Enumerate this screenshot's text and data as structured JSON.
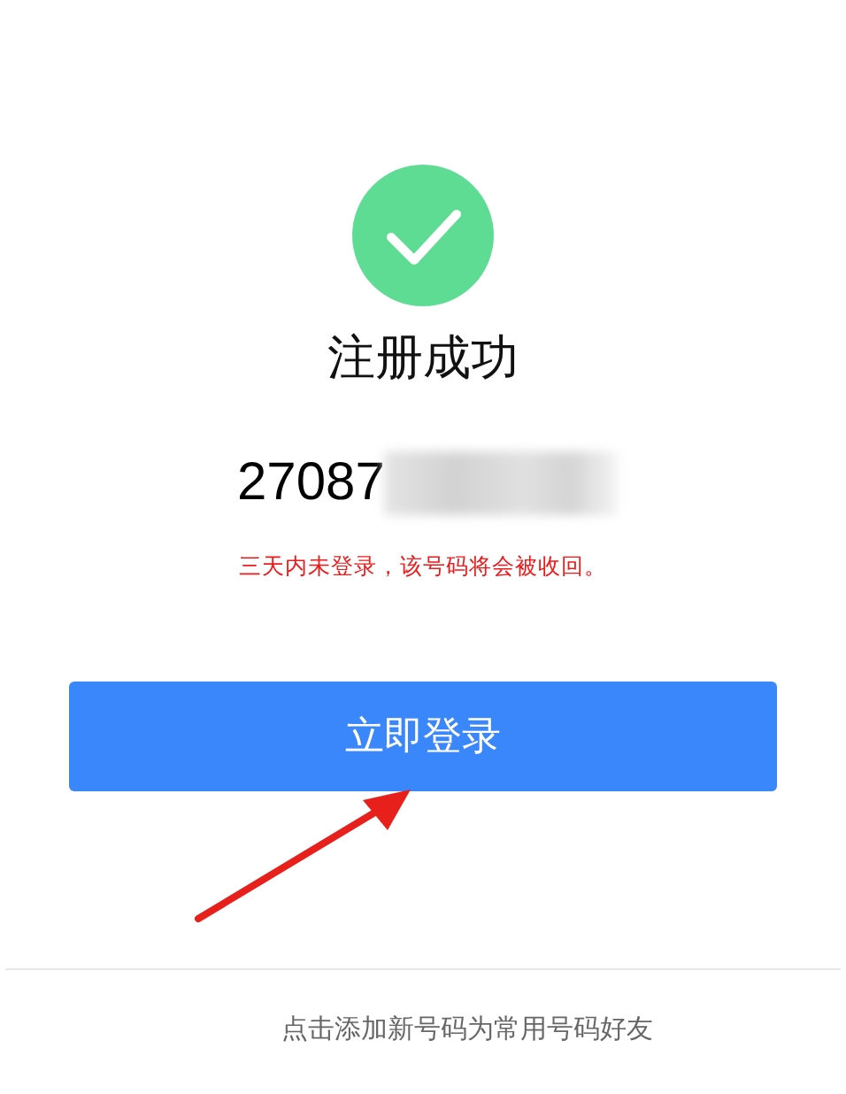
{
  "title": "注册成功",
  "account_number": {
    "visible_part": "27087"
  },
  "warning": "三天内未登录，该号码将会被收回。",
  "login_button": "立即登录",
  "footer_link": "点击添加新号码为常用号码好友"
}
